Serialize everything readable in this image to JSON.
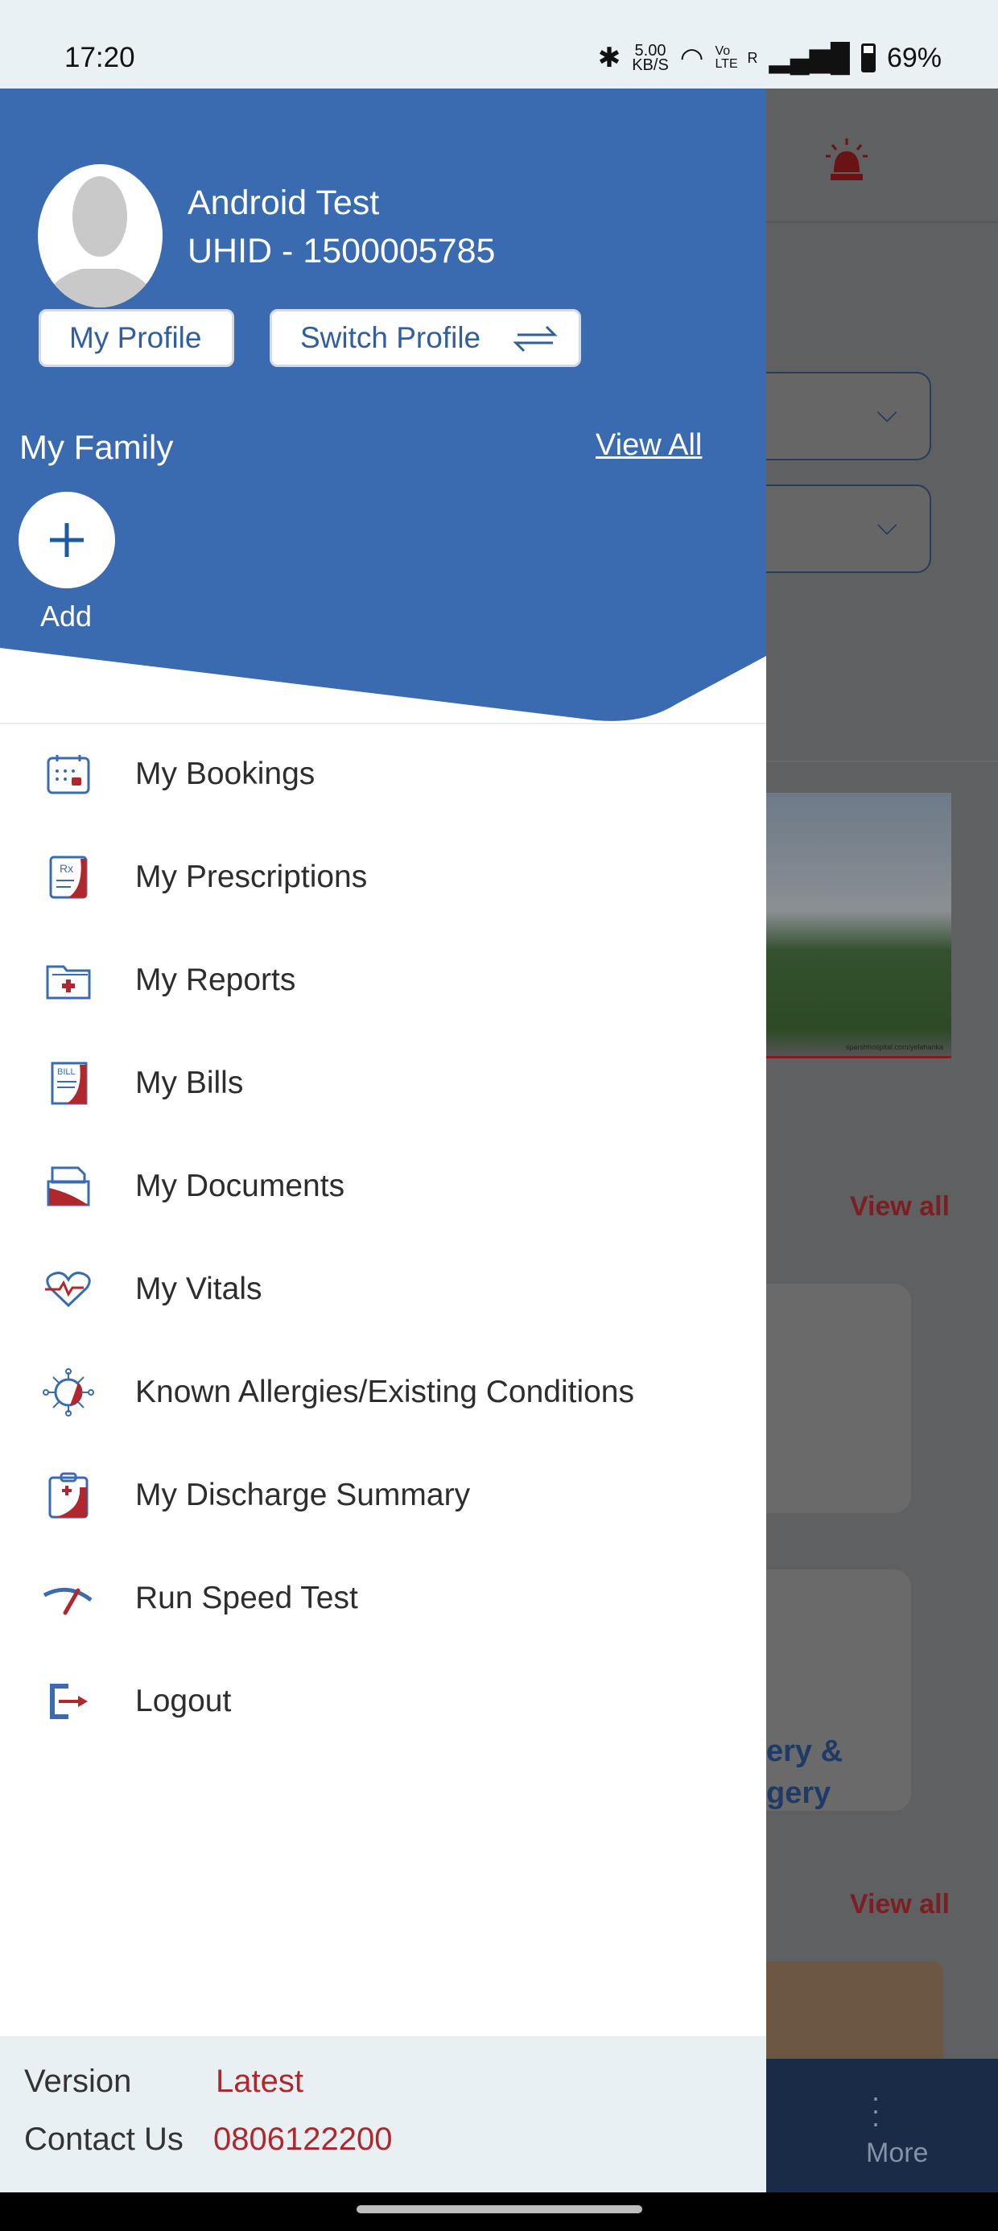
{
  "status_bar": {
    "time": "17:20",
    "net_speed": "5.00",
    "net_unit": "KB/S",
    "volte": "Vo LTE",
    "roaming": "R",
    "battery": "69%"
  },
  "profile": {
    "name": "Android  Test",
    "uhid": "UHID - 1500005785",
    "my_profile": "My Profile",
    "switch_profile": "Switch Profile"
  },
  "family": {
    "title": "My Family",
    "view_all": "View All",
    "add": "Add"
  },
  "menu": [
    {
      "label": "My Bookings",
      "icon": "calendar-icon"
    },
    {
      "label": "My Prescriptions",
      "icon": "prescription-icon"
    },
    {
      "label": "My Reports",
      "icon": "medical-folder-icon"
    },
    {
      "label": "My Bills",
      "icon": "bill-icon"
    },
    {
      "label": "My Documents",
      "icon": "documents-icon"
    },
    {
      "label": "My Vitals",
      "icon": "heart-pulse-icon"
    },
    {
      "label": "Known Allergies/Existing Conditions",
      "icon": "virus-icon"
    },
    {
      "label": "My Discharge Summary",
      "icon": "clipboard-icon"
    },
    {
      "label": "Run Speed Test",
      "icon": "speedometer-icon"
    },
    {
      "label": "Logout",
      "icon": "logout-icon"
    }
  ],
  "footer": {
    "version_label": "Version",
    "version_value": "Latest",
    "contact_label": "Contact Us",
    "contact_value": "0806122200"
  },
  "background": {
    "view_all_1": "View all",
    "view_all_2": "View all",
    "card_text_1": "ery &",
    "card_text_2": "gery",
    "image_caption": "sparshhospital.com/yelahanka",
    "more": "More"
  },
  "colors": {
    "primary": "#3a6bb0",
    "accent_red": "#b0272d",
    "footer_bg": "#e9f0f4"
  }
}
